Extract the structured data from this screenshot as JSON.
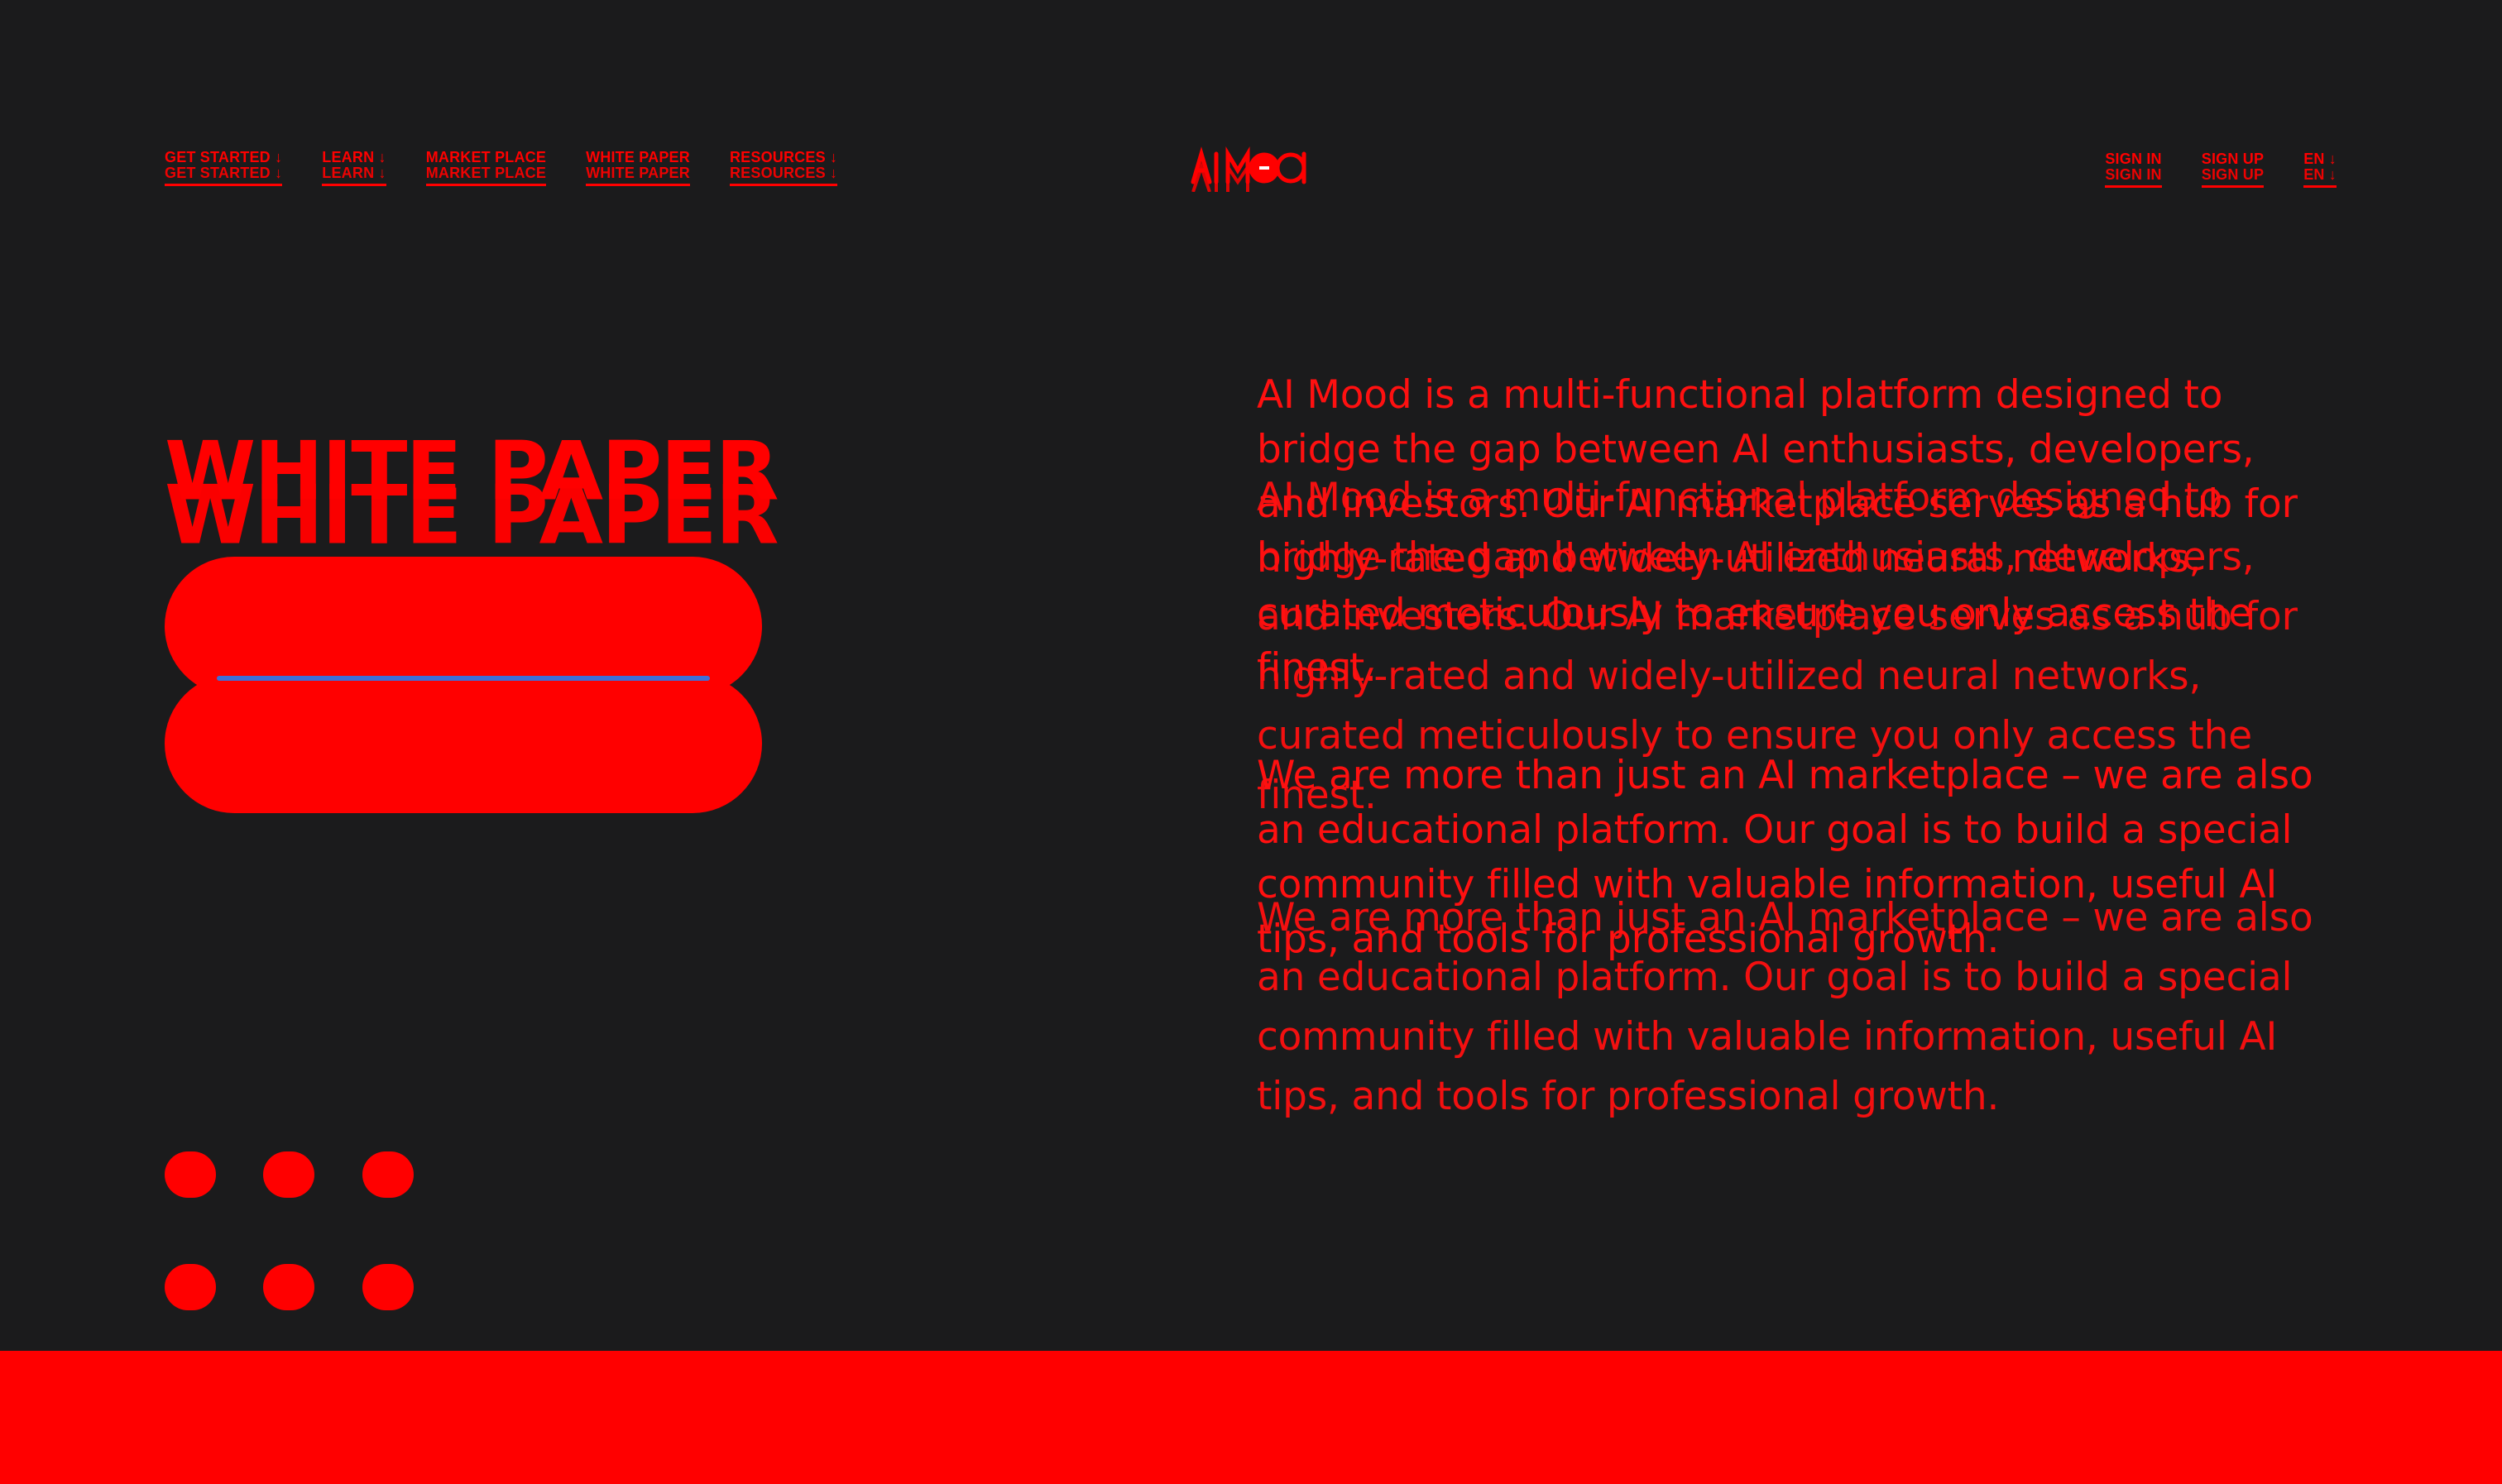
{
  "colors": {
    "background": "#1b1b1c",
    "accent": "#ff0000",
    "underline_accent": "#3f6ed8"
  },
  "nav": {
    "left": [
      {
        "label": "GET STARTED ↓"
      },
      {
        "label": "LEARN ↓"
      },
      {
        "label": "MARKET PLACE"
      },
      {
        "label": "WHITE PAPER"
      },
      {
        "label": "RESOURCES ↓"
      }
    ],
    "right": [
      {
        "label": "SIGN IN"
      },
      {
        "label": "SIGN UP"
      },
      {
        "label": "EN ↓"
      }
    ]
  },
  "logo": {
    "text": "AI MOOD",
    "icon": "ai-mood-logo-icon"
  },
  "hero": {
    "title": "WHITE PAPER"
  },
  "content": {
    "paragraph_1": "AI Mood is a multi-functional platform designed to bridge the gap between AI enthusiasts, developers, and investors. Our AI marketplace serves as a hub for highly-rated and widely-utilized neural networks, curated meticulously to ensure you only access the finest.",
    "paragraph_2": "We are more than just an AI marketplace – we are also an educational platform. Our goal is to build a special community filled with valuable information, useful AI tips, and tools for professional growth."
  },
  "pagination": {
    "dots": 6
  }
}
